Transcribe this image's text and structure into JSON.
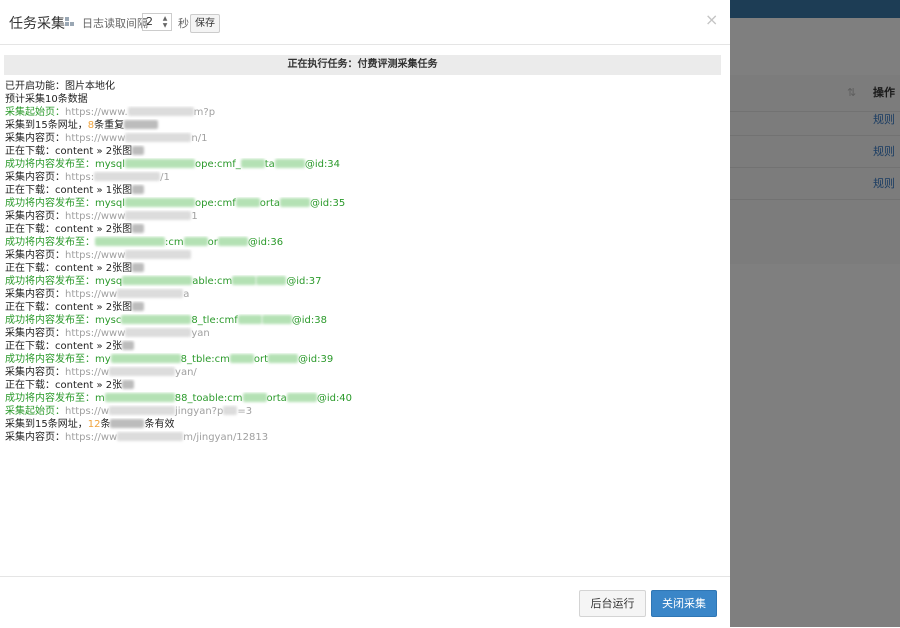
{
  "modal": {
    "title": "任务采集",
    "interval_label": "日志读取间隔",
    "interval_value": "2",
    "seconds_label": "秒",
    "save_label": "保存",
    "close_symbol": "×",
    "status_text": "正在执行任务：付费评测采集任务",
    "log": [
      {
        "label": "已开启功能：图片本地化",
        "value": ""
      },
      {
        "label": "预计采集10条数据",
        "value": ""
      },
      {
        "label": "采集起始页：",
        "value": "https://www.",
        "tail": "m?p"
      },
      {
        "label": "采集到15条网址，",
        "count": "8",
        "rest": "条重复"
      },
      {
        "label": "采集内容页：",
        "value": "https://www",
        "tail": "n/1"
      },
      {
        "label": "正在下载：content » 2张图",
        "value": ""
      },
      {
        "label": "成功将内容发布至：",
        "value": "mysql",
        "mid": "op",
        "tail2": "e:cmf_",
        "mid2": "ta",
        "tail": "@id:34"
      },
      {
        "label": "采集内容页：",
        "value": "https:",
        "tail": "/1"
      },
      {
        "label": "正在下载：content » 1张图",
        "value": ""
      },
      {
        "label": "成功将内容发布至：",
        "value": "mysql",
        "mid": "op",
        "tail2": "e:cmf",
        "mid2": "orta",
        "tail": "@id:35"
      },
      {
        "label": "采集内容页：",
        "value": "https://www",
        "tail": "1"
      },
      {
        "label": "正在下载：content » 2张图",
        "value": ""
      },
      {
        "label": "成功将内容发布至：",
        "value": "",
        "mid": "",
        "tail2": ":cm",
        "mid2": "or",
        "tail": "@id:36"
      },
      {
        "label": "采集内容页：",
        "value": "https://www",
        "tail": ""
      },
      {
        "label": "正在下载：content » 2张图",
        "value": ""
      },
      {
        "label": "成功将内容发布至：",
        "value": "mysq",
        "mid": "",
        "tail2": "able:cm",
        "mid2": "",
        "tail": "@id:37"
      },
      {
        "label": "采集内容页：",
        "value": "https://ww",
        "tail": "a"
      },
      {
        "label": "正在下载：content » 2张图",
        "value": ""
      },
      {
        "label": "成功将内容发布至：",
        "value": "mysc",
        "mid": "8_t",
        "tail2": "le:cmf",
        "mid2": "",
        "tail": "@id:38"
      },
      {
        "label": "采集内容页：",
        "value": "https://www",
        "tail": "yan"
      },
      {
        "label": "正在下载：content » 2张",
        "value": ""
      },
      {
        "label": "成功将内容发布至：",
        "value": "my",
        "mid": "8_t",
        "tail2": "ble:cm",
        "mid2": "ort",
        "tail": "@id:39"
      },
      {
        "label": "采集内容页：",
        "value": "https://w",
        "tail": "yan/"
      },
      {
        "label": "正在下载：content » 2张",
        "value": ""
      },
      {
        "label": "成功将内容发布至：",
        "value": "m",
        "mid": "88_to",
        "tail2": "able:cm",
        "mid2": "orta",
        "tail": "@id:40"
      },
      {
        "label": "采集起始页：",
        "value": "https://w",
        "tail": "jingyan?p",
        "tail3": "=3"
      },
      {
        "label": "采集到15条网址，",
        "count": "12",
        "rest": "条",
        "rest2": "条有效"
      },
      {
        "label": "采集内容页：",
        "value": "https://ww",
        "tail": "m/jingyan/12813"
      }
    ],
    "footer": {
      "background_run": "后台运行",
      "close_collect": "关闭采集"
    }
  },
  "background_page": {
    "column_header": "操作",
    "sort_icon": "sort-icon",
    "rows": [
      "规则",
      "规则",
      "规则"
    ]
  },
  "colors": {
    "success": "#2b9a2b",
    "link": "#a0a0a0",
    "count": "#f0a33c",
    "primary": "#3a86c8"
  }
}
